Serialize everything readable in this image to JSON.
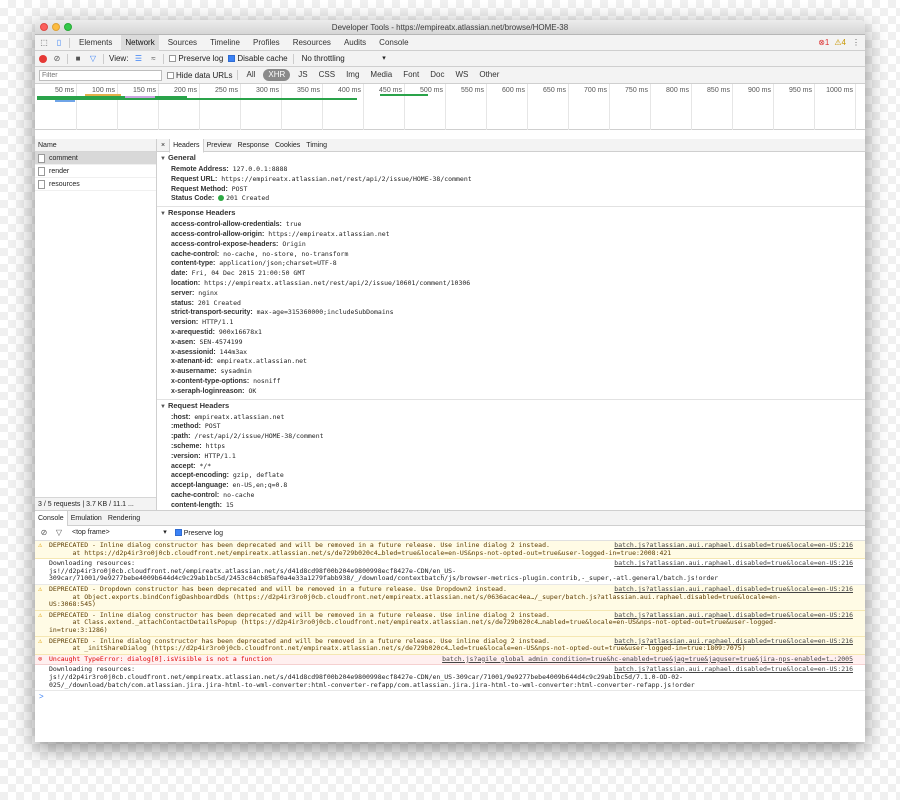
{
  "window": {
    "title": "Developer Tools - https://empireatx.atlassian.net/browse/HOME-38"
  },
  "tabs": [
    "Elements",
    "Network",
    "Sources",
    "Timeline",
    "Profiles",
    "Resources",
    "Audits",
    "Console"
  ],
  "active_tab": "Network",
  "badges": {
    "errors": "1",
    "warnings": "4"
  },
  "toolbar": {
    "view_label": "View:",
    "preserve_log": "Preserve log",
    "disable_cache": "Disable cache",
    "throttling": "No throttling"
  },
  "filter": {
    "placeholder": "Filter",
    "hide_data_urls": "Hide data URLs",
    "types": [
      "All",
      "XHR",
      "JS",
      "CSS",
      "Img",
      "Media",
      "Font",
      "Doc",
      "WS",
      "Other"
    ],
    "active_type": "XHR"
  },
  "timeline": {
    "ticks": [
      "50 ms",
      "100 ms",
      "150 ms",
      "200 ms",
      "250 ms",
      "300 ms",
      "350 ms",
      "400 ms",
      "450 ms",
      "500 ms",
      "550 ms",
      "600 ms",
      "650 ms",
      "700 ms",
      "750 ms",
      "800 ms",
      "850 ms",
      "900 ms",
      "950 ms",
      "1000 ms"
    ]
  },
  "requests": {
    "header": "Name",
    "items": [
      "comment",
      "render",
      "resources"
    ],
    "selected": "comment",
    "footer": "3 / 5 requests | 3.7 KB / 11.1 ..."
  },
  "details": {
    "tabs": [
      "Headers",
      "Preview",
      "Response",
      "Cookies",
      "Timing"
    ],
    "active_tab": "Headers",
    "general": {
      "title": "General",
      "rows": [
        {
          "k": "Remote Address:",
          "v": "127.0.0.1:8888"
        },
        {
          "k": "Request URL:",
          "v": "https://empireatx.atlassian.net/rest/api/2/issue/HOME-38/comment"
        },
        {
          "k": "Request Method:",
          "v": "POST"
        },
        {
          "k": "Status Code:",
          "v": "201 Created"
        }
      ]
    },
    "response_headers": {
      "title": "Response Headers",
      "rows": [
        {
          "k": "access-control-allow-credentials:",
          "v": "true"
        },
        {
          "k": "access-control-allow-origin:",
          "v": "https://empireatx.atlassian.net"
        },
        {
          "k": "access-control-expose-headers:",
          "v": "Origin"
        },
        {
          "k": "cache-control:",
          "v": "no-cache, no-store, no-transform"
        },
        {
          "k": "content-type:",
          "v": "application/json;charset=UTF-8"
        },
        {
          "k": "date:",
          "v": "Fri, 04 Dec 2015 21:00:50 GMT"
        },
        {
          "k": "location:",
          "v": "https://empireatx.atlassian.net/rest/api/2/issue/10601/comment/10306"
        },
        {
          "k": "server:",
          "v": "nginx"
        },
        {
          "k": "status:",
          "v": "201 Created"
        },
        {
          "k": "strict-transport-security:",
          "v": "max-age=315360000;includeSubDomains"
        },
        {
          "k": "version:",
          "v": "HTTP/1.1"
        },
        {
          "k": "x-arequestid:",
          "v": "900x16678x1"
        },
        {
          "k": "x-asen:",
          "v": "SEN-4574199"
        },
        {
          "k": "x-asessionid:",
          "v": "144m3ax"
        },
        {
          "k": "x-atenant-id:",
          "v": "empireatx.atlassian.net"
        },
        {
          "k": "x-ausername:",
          "v": "sysadmin"
        },
        {
          "k": "x-content-type-options:",
          "v": "nosniff"
        },
        {
          "k": "x-seraph-loginreason:",
          "v": "OK"
        }
      ]
    },
    "request_headers": {
      "title": "Request Headers",
      "rows": [
        {
          "k": ":host:",
          "v": "empireatx.atlassian.net"
        },
        {
          "k": ":method:",
          "v": "POST"
        },
        {
          "k": ":path:",
          "v": "/rest/api/2/issue/HOME-38/comment"
        },
        {
          "k": ":scheme:",
          "v": "https"
        },
        {
          "k": ":version:",
          "v": "HTTP/1.1"
        },
        {
          "k": "accept:",
          "v": "*/*"
        },
        {
          "k": "accept-encoding:",
          "v": "gzip, deflate"
        },
        {
          "k": "accept-language:",
          "v": "en-US,en;q=0.8"
        },
        {
          "k": "cache-control:",
          "v": "no-cache"
        },
        {
          "k": "content-length:",
          "v": "15"
        }
      ]
    }
  },
  "console": {
    "tabs": [
      "Console",
      "Emulation",
      "Rendering"
    ],
    "active_tab": "Console",
    "frame": "<top frame>",
    "preserve_log": "Preserve log",
    "messages": [
      {
        "level": "warn",
        "text": "DEPRECATED - Inline dialog constructor has been deprecated and will be removed in a future release. Use inline dialog 2 instead.\n      at https://d2p4ir3ro0j0cb.cloudfront.net/empireatx.atlassian.net/s/de729b020c4…bled=true&locale=en-US&nps-not-opted-out=true&user-logged-in=true:2008:421",
        "source": "batch.js?atlassian.aui.raphael.disabled=true&locale=en-US:216"
      },
      {
        "level": "log",
        "text": "Downloading resources:\njs!//d2p4ir3ro0j0cb.cloudfront.net/empireatx.atlassian.net/s/d41d8cd98f00b204e9800998ecf8427e-CDN/en_US-\n309car/71001/9e9277bebe4009b644d4c9c29ab1bc5d/2453c04cb85af0a4e33a1279fabb938/_/download/contextbatch/js/browser-metrics-plugin.contrib,-_super,-atl.general/batch.js!order",
        "source": "batch.js?atlassian.aui.raphael.disabled=true&locale=en-US:216"
      },
      {
        "level": "warn",
        "text": "DEPRECATED - Dropdown constructor has been deprecated and will be removed in a future release. Use Dropdown2 instead.\n      at Object.exports.bindConfigDashboardDds (https://d2p4ir3ro0j0cb.cloudfront.net/empireatx.atlassian.net/s/0636acac4ea…/_super/batch.js?atlassian.aui.raphael.disabled=true&locale=en-\nUS:3068:545)",
        "source": "batch.js?atlassian.aui.raphael.disabled=true&locale=en-US:216"
      },
      {
        "level": "warn",
        "text": "DEPRECATED - Inline dialog constructor has been deprecated and will be removed in a future release. Use inline dialog 2 instead.\n      at Class.extend._attachContactDetailsPopup (https://d2p4ir3ro0j0cb.cloudfront.net/empireatx.atlassian.net/s/de729b020c4…nabled=true&locale=en-US&nps-not-opted-out=true&user-logged-\nin=true:3:1286)",
        "source": "batch.js?atlassian.aui.raphael.disabled=true&locale=en-US:216"
      },
      {
        "level": "warn",
        "text": "DEPRECATED - Inline dialog constructor has been deprecated and will be removed in a future release. Use inline dialog 2 instead.\n      at _initShareDialog (https://d2p4ir3ro0j0cb.cloudfront.net/empireatx.atlassian.net/s/de729b020c4…led=true&locale=en-US&nps-not-opted-out=true&user-logged-in=true:1809:7075)",
        "source": "batch.js?atlassian.aui.raphael.disabled=true&locale=en-US:216"
      },
      {
        "level": "error",
        "text": "Uncaught TypeError: dialog[0].isVisible is not a function",
        "source": "batch.js?agile_global_admin_condition=true&hc-enabled=true&jag=true&jaguser=true&jira-nps-enabled=t…:2005"
      },
      {
        "level": "log",
        "text": "Downloading resources:\njs!//d2p4ir3ro0j0cb.cloudfront.net/empireatx.atlassian.net/s/d41d8cd98f00b204e9800998ecf8427e-CDN/en_US-309car/71001/9e9277bebe4009b644d4c9c29ab1bc5d/7.1.0-OD-02-\n025/_/download/batch/com.atlassian.jira.jira-html-to-wml-converter:html-converter-refapp/com.atlassian.jira.jira-html-to-wml-converter:html-converter-refapp.js!order",
        "source": "batch.js?atlassian.aui.raphael.disabled=true&locale=en-US:216"
      }
    ],
    "prompt": ">"
  },
  "colors": {
    "record": "#e53935",
    "status_ok": "#2eaa44",
    "warn_bg": "#fffbe5",
    "error_text": "#d00"
  }
}
